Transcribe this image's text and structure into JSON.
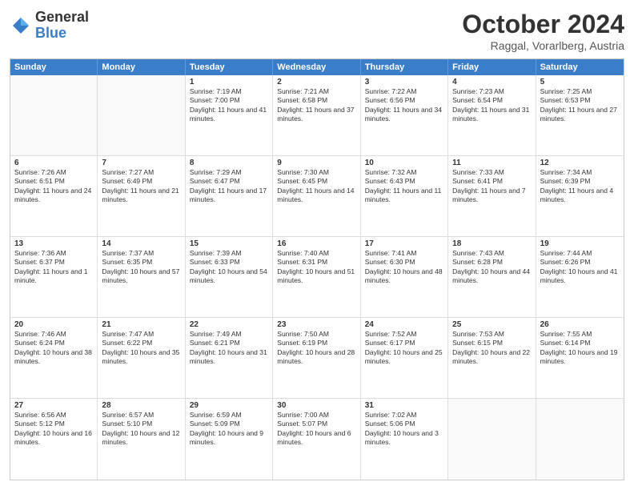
{
  "header": {
    "logo_general": "General",
    "logo_blue": "Blue",
    "month_title": "October 2024",
    "location": "Raggal, Vorarlberg, Austria"
  },
  "days_of_week": [
    "Sunday",
    "Monday",
    "Tuesday",
    "Wednesday",
    "Thursday",
    "Friday",
    "Saturday"
  ],
  "rows": [
    [
      {
        "day": "",
        "sunrise": "",
        "sunset": "",
        "daylight": "",
        "empty": true
      },
      {
        "day": "",
        "sunrise": "",
        "sunset": "",
        "daylight": "",
        "empty": true
      },
      {
        "day": "1",
        "sunrise": "Sunrise: 7:19 AM",
        "sunset": "Sunset: 7:00 PM",
        "daylight": "Daylight: 11 hours and 41 minutes.",
        "empty": false
      },
      {
        "day": "2",
        "sunrise": "Sunrise: 7:21 AM",
        "sunset": "Sunset: 6:58 PM",
        "daylight": "Daylight: 11 hours and 37 minutes.",
        "empty": false
      },
      {
        "day": "3",
        "sunrise": "Sunrise: 7:22 AM",
        "sunset": "Sunset: 6:56 PM",
        "daylight": "Daylight: 11 hours and 34 minutes.",
        "empty": false
      },
      {
        "day": "4",
        "sunrise": "Sunrise: 7:23 AM",
        "sunset": "Sunset: 6:54 PM",
        "daylight": "Daylight: 11 hours and 31 minutes.",
        "empty": false
      },
      {
        "day": "5",
        "sunrise": "Sunrise: 7:25 AM",
        "sunset": "Sunset: 6:53 PM",
        "daylight": "Daylight: 11 hours and 27 minutes.",
        "empty": false
      }
    ],
    [
      {
        "day": "6",
        "sunrise": "Sunrise: 7:26 AM",
        "sunset": "Sunset: 6:51 PM",
        "daylight": "Daylight: 11 hours and 24 minutes.",
        "empty": false
      },
      {
        "day": "7",
        "sunrise": "Sunrise: 7:27 AM",
        "sunset": "Sunset: 6:49 PM",
        "daylight": "Daylight: 11 hours and 21 minutes.",
        "empty": false
      },
      {
        "day": "8",
        "sunrise": "Sunrise: 7:29 AM",
        "sunset": "Sunset: 6:47 PM",
        "daylight": "Daylight: 11 hours and 17 minutes.",
        "empty": false
      },
      {
        "day": "9",
        "sunrise": "Sunrise: 7:30 AM",
        "sunset": "Sunset: 6:45 PM",
        "daylight": "Daylight: 11 hours and 14 minutes.",
        "empty": false
      },
      {
        "day": "10",
        "sunrise": "Sunrise: 7:32 AM",
        "sunset": "Sunset: 6:43 PM",
        "daylight": "Daylight: 11 hours and 11 minutes.",
        "empty": false
      },
      {
        "day": "11",
        "sunrise": "Sunrise: 7:33 AM",
        "sunset": "Sunset: 6:41 PM",
        "daylight": "Daylight: 11 hours and 7 minutes.",
        "empty": false
      },
      {
        "day": "12",
        "sunrise": "Sunrise: 7:34 AM",
        "sunset": "Sunset: 6:39 PM",
        "daylight": "Daylight: 11 hours and 4 minutes.",
        "empty": false
      }
    ],
    [
      {
        "day": "13",
        "sunrise": "Sunrise: 7:36 AM",
        "sunset": "Sunset: 6:37 PM",
        "daylight": "Daylight: 11 hours and 1 minute.",
        "empty": false
      },
      {
        "day": "14",
        "sunrise": "Sunrise: 7:37 AM",
        "sunset": "Sunset: 6:35 PM",
        "daylight": "Daylight: 10 hours and 57 minutes.",
        "empty": false
      },
      {
        "day": "15",
        "sunrise": "Sunrise: 7:39 AM",
        "sunset": "Sunset: 6:33 PM",
        "daylight": "Daylight: 10 hours and 54 minutes.",
        "empty": false
      },
      {
        "day": "16",
        "sunrise": "Sunrise: 7:40 AM",
        "sunset": "Sunset: 6:31 PM",
        "daylight": "Daylight: 10 hours and 51 minutes.",
        "empty": false
      },
      {
        "day": "17",
        "sunrise": "Sunrise: 7:41 AM",
        "sunset": "Sunset: 6:30 PM",
        "daylight": "Daylight: 10 hours and 48 minutes.",
        "empty": false
      },
      {
        "day": "18",
        "sunrise": "Sunrise: 7:43 AM",
        "sunset": "Sunset: 6:28 PM",
        "daylight": "Daylight: 10 hours and 44 minutes.",
        "empty": false
      },
      {
        "day": "19",
        "sunrise": "Sunrise: 7:44 AM",
        "sunset": "Sunset: 6:26 PM",
        "daylight": "Daylight: 10 hours and 41 minutes.",
        "empty": false
      }
    ],
    [
      {
        "day": "20",
        "sunrise": "Sunrise: 7:46 AM",
        "sunset": "Sunset: 6:24 PM",
        "daylight": "Daylight: 10 hours and 38 minutes.",
        "empty": false
      },
      {
        "day": "21",
        "sunrise": "Sunrise: 7:47 AM",
        "sunset": "Sunset: 6:22 PM",
        "daylight": "Daylight: 10 hours and 35 minutes.",
        "empty": false
      },
      {
        "day": "22",
        "sunrise": "Sunrise: 7:49 AM",
        "sunset": "Sunset: 6:21 PM",
        "daylight": "Daylight: 10 hours and 31 minutes.",
        "empty": false
      },
      {
        "day": "23",
        "sunrise": "Sunrise: 7:50 AM",
        "sunset": "Sunset: 6:19 PM",
        "daylight": "Daylight: 10 hours and 28 minutes.",
        "empty": false
      },
      {
        "day": "24",
        "sunrise": "Sunrise: 7:52 AM",
        "sunset": "Sunset: 6:17 PM",
        "daylight": "Daylight: 10 hours and 25 minutes.",
        "empty": false
      },
      {
        "day": "25",
        "sunrise": "Sunrise: 7:53 AM",
        "sunset": "Sunset: 6:15 PM",
        "daylight": "Daylight: 10 hours and 22 minutes.",
        "empty": false
      },
      {
        "day": "26",
        "sunrise": "Sunrise: 7:55 AM",
        "sunset": "Sunset: 6:14 PM",
        "daylight": "Daylight: 10 hours and 19 minutes.",
        "empty": false
      }
    ],
    [
      {
        "day": "27",
        "sunrise": "Sunrise: 6:56 AM",
        "sunset": "Sunset: 5:12 PM",
        "daylight": "Daylight: 10 hours and 16 minutes.",
        "empty": false
      },
      {
        "day": "28",
        "sunrise": "Sunrise: 6:57 AM",
        "sunset": "Sunset: 5:10 PM",
        "daylight": "Daylight: 10 hours and 12 minutes.",
        "empty": false
      },
      {
        "day": "29",
        "sunrise": "Sunrise: 6:59 AM",
        "sunset": "Sunset: 5:09 PM",
        "daylight": "Daylight: 10 hours and 9 minutes.",
        "empty": false
      },
      {
        "day": "30",
        "sunrise": "Sunrise: 7:00 AM",
        "sunset": "Sunset: 5:07 PM",
        "daylight": "Daylight: 10 hours and 6 minutes.",
        "empty": false
      },
      {
        "day": "31",
        "sunrise": "Sunrise: 7:02 AM",
        "sunset": "Sunset: 5:06 PM",
        "daylight": "Daylight: 10 hours and 3 minutes.",
        "empty": false
      },
      {
        "day": "",
        "sunrise": "",
        "sunset": "",
        "daylight": "",
        "empty": true
      },
      {
        "day": "",
        "sunrise": "",
        "sunset": "",
        "daylight": "",
        "empty": true
      }
    ]
  ]
}
